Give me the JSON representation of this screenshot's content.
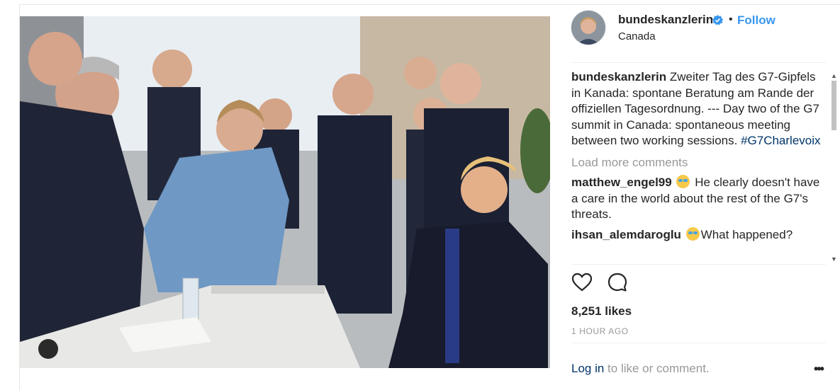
{
  "post": {
    "image_alt": "G7 leaders around a table"
  },
  "header": {
    "username": "bundeskanzlerin",
    "separator": "•",
    "follow_label": "Follow",
    "location": "Canada"
  },
  "caption": {
    "username": "bundeskanzlerin",
    "text": "Zweiter Tag des G7-Gipfels in Kanada: spontane Beratung am Rande der offiziellen Tagesordnung. --- Day two of the G7 summit in Canada: spontaneous meeting between two working sessions. ",
    "hashtag": "#G7Charlevoix"
  },
  "load_more": "Load more comments",
  "comments": [
    {
      "username": "matthew_engel99",
      "text": "He clearly doesn't have a care in the world about the rest of the G7's threats."
    },
    {
      "username": "ihsan_alemdaroglu",
      "text": "What happened?"
    }
  ],
  "likes": "8,251 likes",
  "timestamp": "1 HOUR AGO",
  "login": {
    "link": "Log in",
    "rest": " to like or comment.",
    "options": "•••"
  },
  "icons": {
    "verified": "verified-badge-icon",
    "like": "heart-icon",
    "comment": "comment-bubble-icon",
    "options": "more-options-icon"
  },
  "colors": {
    "accent": "#3897f0",
    "hashtag": "#003569",
    "muted": "#999999",
    "text": "#262626"
  }
}
